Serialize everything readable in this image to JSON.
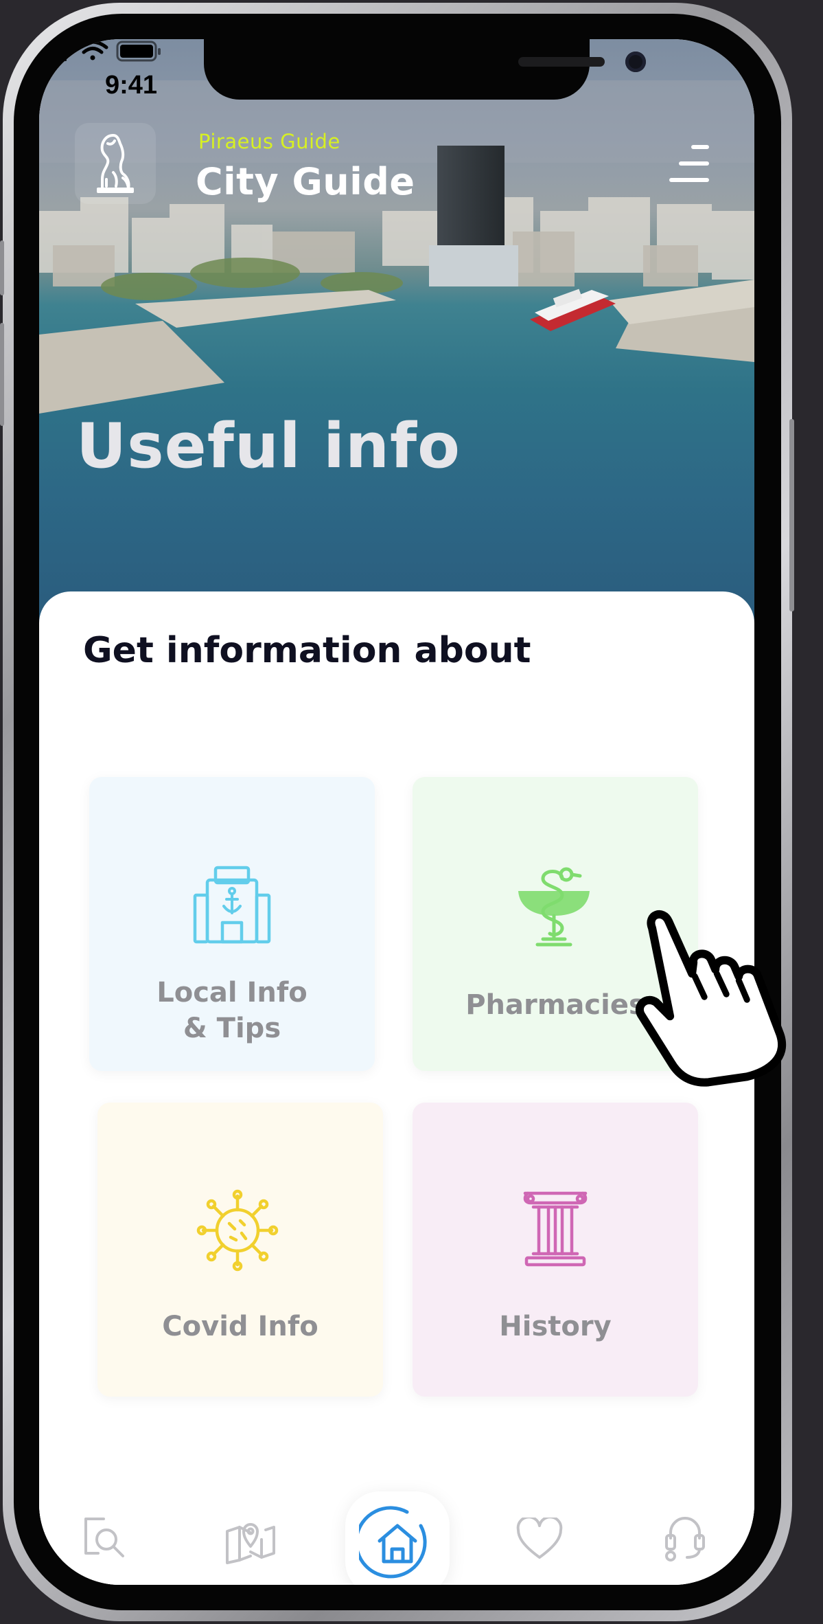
{
  "status_bar": {
    "time": "9:41"
  },
  "header": {
    "brand_subtitle": "Piraeus Guide",
    "brand_title": "City Guide",
    "logo_icon": "lion-statue-icon",
    "menu_icon": "hamburger-menu-icon"
  },
  "hero": {
    "title": "Useful info"
  },
  "main": {
    "section_title": "Get information about",
    "cards": [
      {
        "line1": "Local Info",
        "line2": "& Tips",
        "icon": "port-building-anchor-icon",
        "color": "#62cdeb",
        "background": "#f0f8fd"
      },
      {
        "line1": "Pharmacies",
        "icon": "pharmacy-bowl-of-hygieia-icon",
        "color": "#7fdc6e",
        "background": "#eefaee"
      },
      {
        "line1": "Covid Info",
        "icon": "virus-icon",
        "color": "#f1d02e",
        "background": "#fefaee"
      },
      {
        "line1": "History",
        "icon": "ionic-column-icon",
        "color": "#cf67b4",
        "background": "#f8edf6"
      }
    ]
  },
  "tabbar": {
    "items": [
      {
        "icon": "search-map-icon",
        "active": false
      },
      {
        "icon": "map-location-pin-icon",
        "active": false
      },
      {
        "icon": "home-icon",
        "active": true
      },
      {
        "icon": "heart-icon",
        "active": false
      },
      {
        "icon": "support-headset-icon",
        "active": false
      }
    ],
    "active_color": "#2b8ee0",
    "inactive_color": "#c2c2c6"
  }
}
